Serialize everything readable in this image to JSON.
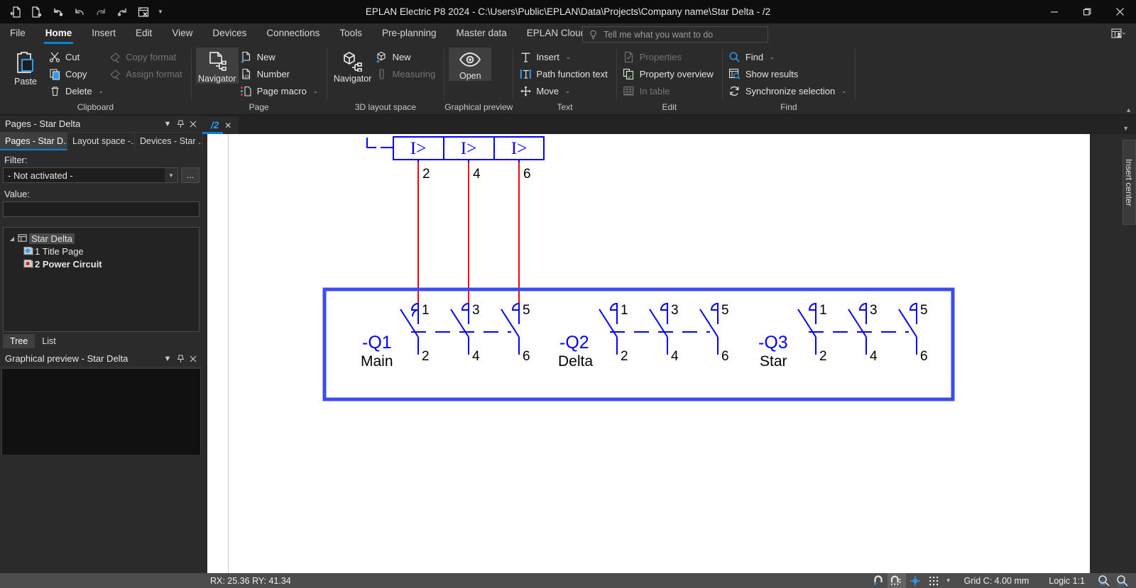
{
  "window": {
    "title": "EPLAN Electric P8 2024 - C:\\Users\\Public\\EPLAN\\Data\\Projects\\Company name\\Star Delta - /2",
    "minimize": "minimize-icon",
    "maximize": "maximize-icon",
    "close": "close-icon"
  },
  "quick_access": [
    {
      "name": "open-project-icon"
    },
    {
      "name": "close-project-icon"
    },
    {
      "name": "undo-icon"
    },
    {
      "name": "undo-arrow-icon"
    },
    {
      "name": "redo-arrow-icon"
    },
    {
      "name": "redo-icon"
    },
    {
      "name": "cancel-action-icon"
    }
  ],
  "menu": {
    "tabs": [
      {
        "label": "File",
        "active": false
      },
      {
        "label": "Home",
        "active": true
      },
      {
        "label": "Insert",
        "active": false
      },
      {
        "label": "Edit",
        "active": false
      },
      {
        "label": "View",
        "active": false
      },
      {
        "label": "Devices",
        "active": false
      },
      {
        "label": "Connections",
        "active": false
      },
      {
        "label": "Tools",
        "active": false
      },
      {
        "label": "Pre-planning",
        "active": false
      },
      {
        "label": "Master data",
        "active": false
      },
      {
        "label": "EPLAN Cloud",
        "active": false
      }
    ]
  },
  "search": {
    "placeholder": "Tell me what you want to do"
  },
  "ribbon": {
    "groups": [
      {
        "title": "Clipboard",
        "big": {
          "label": "Paste",
          "icon": "paste-icon"
        },
        "items": [
          {
            "label": "Cut",
            "icon": "scissors-icon",
            "disabled": false,
            "caret": false
          },
          {
            "label": "Copy",
            "icon": "copy-icon",
            "disabled": false,
            "caret": false
          },
          {
            "label": "Delete",
            "icon": "trash-icon",
            "disabled": false,
            "caret": true
          }
        ],
        "items2": [
          {
            "label": "Copy format",
            "icon": "format-brush-icon",
            "disabled": true,
            "caret": false
          },
          {
            "label": "Assign format",
            "icon": "format-brush-icon",
            "disabled": true,
            "caret": false
          }
        ]
      },
      {
        "title": "Page",
        "big": {
          "label": "Navigator",
          "icon": "page-navigator-icon",
          "selected": true
        },
        "items": [
          {
            "label": "New",
            "icon": "new-page-icon",
            "disabled": false,
            "caret": false
          },
          {
            "label": "Number",
            "icon": "number-page-icon",
            "disabled": false,
            "caret": false
          },
          {
            "label": "Page macro",
            "icon": "page-macro-icon",
            "disabled": false,
            "caret": true
          }
        ]
      },
      {
        "title": "3D layout space",
        "big": {
          "label": "Navigator",
          "icon": "cube-navigator-icon"
        },
        "items": [
          {
            "label": "New",
            "icon": "new-cube-icon",
            "disabled": false,
            "caret": false
          },
          {
            "label": "Measuring",
            "icon": "measuring-icon",
            "disabled": true,
            "caret": false
          }
        ]
      },
      {
        "title": "Graphical preview",
        "big": {
          "label": "Open",
          "icon": "eye-icon",
          "selected": true
        }
      },
      {
        "title": "Text",
        "items": [
          {
            "label": "Insert",
            "icon": "text-insert-icon",
            "disabled": false,
            "caret": true
          },
          {
            "label": "Path function text",
            "icon": "path-function-text-icon",
            "disabled": false,
            "caret": false
          },
          {
            "label": "Move",
            "icon": "move-icon",
            "disabled": false,
            "caret": true
          }
        ]
      },
      {
        "title": "Edit",
        "items": [
          {
            "label": "Properties",
            "icon": "properties-icon",
            "disabled": true,
            "caret": false
          },
          {
            "label": "Property overview",
            "icon": "property-overview-icon",
            "disabled": false,
            "caret": false
          },
          {
            "label": "In table",
            "icon": "in-table-icon",
            "disabled": true,
            "caret": false
          }
        ]
      },
      {
        "title": "Find",
        "items": [
          {
            "label": "Find",
            "icon": "search-icon",
            "disabled": false,
            "caret": true
          },
          {
            "label": "Show results",
            "icon": "show-results-icon",
            "disabled": false,
            "caret": false
          },
          {
            "label": "Synchronize selection",
            "icon": "sync-icon",
            "disabled": false,
            "caret": true
          }
        ]
      }
    ]
  },
  "pages_panel": {
    "title": "Pages - Star Delta",
    "dock_tabs": [
      {
        "label": "Pages - Star D...",
        "active": true
      },
      {
        "label": "Layout space -...",
        "active": false
      },
      {
        "label": "Devices - Star ...",
        "active": false
      }
    ],
    "filter_label": "Filter:",
    "filter_value": "- Not activated -",
    "filter_more": "...",
    "value_label": "Value:",
    "value_text": "",
    "tree": [
      {
        "label": "Star Delta",
        "icon": "project-icon",
        "level": 0,
        "selected": true,
        "bold": false,
        "expanded": true
      },
      {
        "label": "1 Title Page",
        "icon": "title-page-icon",
        "level": 1,
        "selected": false,
        "bold": false
      },
      {
        "label": "2 Power Circuit",
        "icon": "power-page-icon",
        "level": 1,
        "selected": false,
        "bold": true
      }
    ],
    "view_tabs": [
      {
        "label": "Tree",
        "active": true
      },
      {
        "label": "List",
        "active": false
      }
    ]
  },
  "preview_panel": {
    "title": "Graphical preview - Star Delta"
  },
  "document": {
    "tab_label": "/2",
    "tab_close": "close-icon"
  },
  "insert_center": {
    "label": "Insert center"
  },
  "statusbar": {
    "coords": "RX: 25.36 RY: 41.34",
    "grid": "Grid C: 4.00 mm",
    "logic": "Logic 1:1",
    "icons": [
      {
        "name": "snap-magnet-icon",
        "active": false
      },
      {
        "name": "snap-grid-magnet-icon",
        "active": true
      },
      {
        "name": "crosshair-icon",
        "active": false
      },
      {
        "name": "grid-dots-icon",
        "active": false
      },
      {
        "name": "grid-caret-icon",
        "active": false
      },
      {
        "name": "zoom-region-icon",
        "active": false
      },
      {
        "name": "zoom-100-icon",
        "active": false
      }
    ]
  },
  "schematic": {
    "overload_relay": {
      "symbol": "I>",
      "poles": [
        {
          "symbol": "I>",
          "terminal": "2"
        },
        {
          "symbol": "I>",
          "terminal": "4"
        },
        {
          "symbol": "I>",
          "terminal": "6"
        }
      ]
    },
    "selection_box": {
      "color": "#3b4cf0"
    },
    "wire_color": "#ff0000",
    "symbol_color": "#0000ff",
    "contactors": [
      {
        "tag": "-Q1",
        "function": "Main",
        "terminals_top": [
          "1",
          "3",
          "5"
        ],
        "terminals_bottom": [
          "2",
          "4",
          "6"
        ]
      },
      {
        "tag": "-Q2",
        "function": "Delta",
        "terminals_top": [
          "1",
          "3",
          "5"
        ],
        "terminals_bottom": [
          "2",
          "4",
          "6"
        ]
      },
      {
        "tag": "-Q3",
        "function": "Star",
        "terminals_top": [
          "1",
          "3",
          "5"
        ],
        "terminals_bottom": [
          "2",
          "4",
          "6"
        ]
      }
    ]
  }
}
